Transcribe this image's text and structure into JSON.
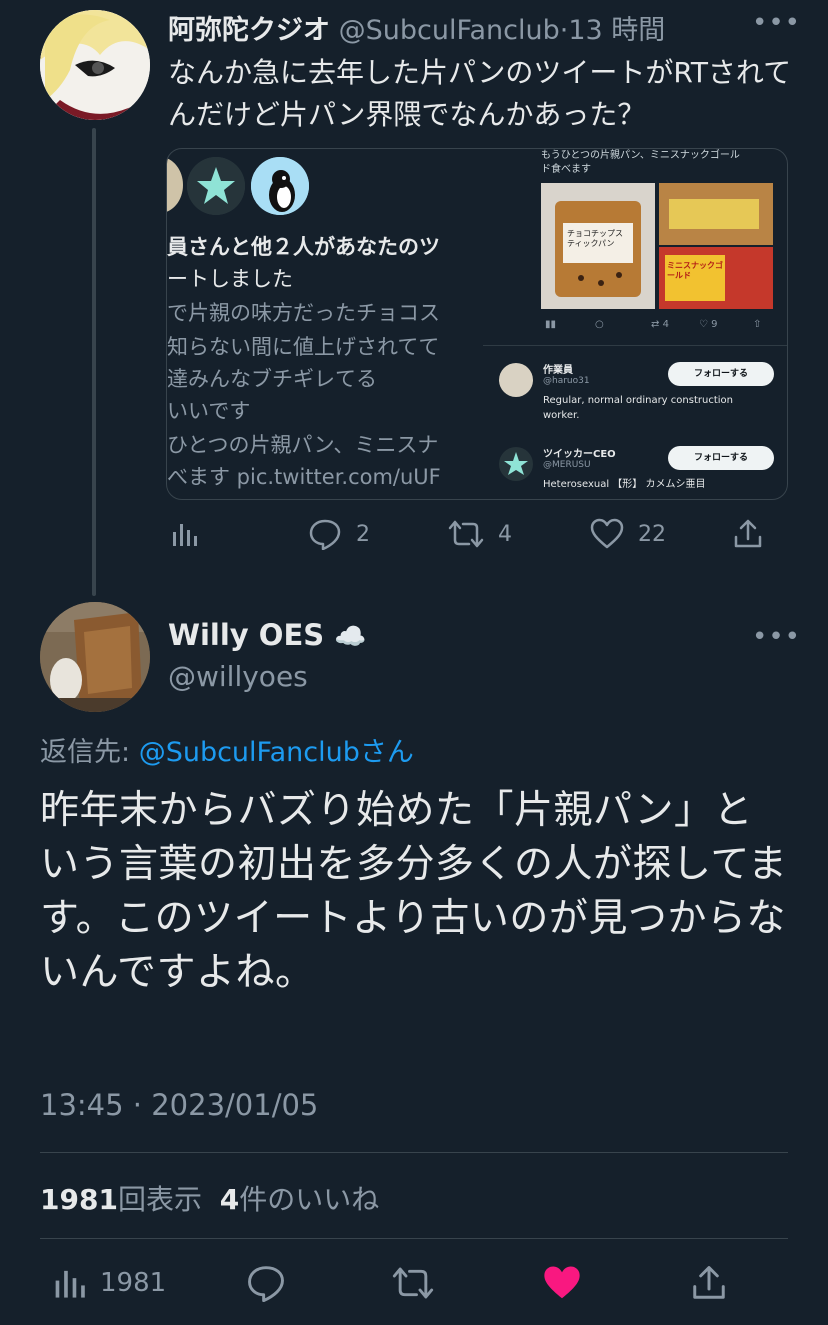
{
  "parent_tweet": {
    "display_name": "阿弥陀クジオ",
    "handle": "@SubculFanclub",
    "separator": "·",
    "time": "13 時間",
    "more": "•••",
    "text": "なんか急に去年した片パンのツイートがRTされてんだけど片パン界隈でなんかあった？",
    "embedded": {
      "notification_lines": [
        "員さんと他２人があなたのツ",
        "ートしました",
        "で片親の味方だったチョコス",
        "知らない間に値上げされてて",
        "達みんなブチギレてる",
        "いいです",
        "ひとつの片親パン、ミニスナ",
        "べます pic.twitter.com/uUF"
      ],
      "right_caption": "もうひとつの片親パン、ミニスナックゴールド食べます",
      "bread_labels": [
        "チョコチップスティックパン",
        "ミニスナックゴールド"
      ],
      "mini_actions": {
        "retweets": "4",
        "likes": "9"
      },
      "accounts": [
        {
          "name": "作業員",
          "handle": "@haruo31",
          "bio": "Regular, normal ordinary construction worker.",
          "button": "フォローする"
        },
        {
          "name": "ツイッカーCEO",
          "handle": "@MERUSU",
          "bio": "Heterosexual 【形】 カメムシ亜目",
          "button": "フォローする"
        }
      ]
    },
    "actions": {
      "replies": "2",
      "retweets": "4",
      "likes": "22"
    }
  },
  "reply_tweet": {
    "display_name": "Willy OES",
    "name_emoji": "☁️",
    "handle": "@willyoes",
    "more": "•••",
    "reply_to_prefix": "返信先: ",
    "reply_to_handle": "@SubculFanclub",
    "reply_to_suffix": "さん",
    "text": "昨年末からバズり始めた「片親パン」という言葉の初出を多分多くの人が探してます。このツイートより古いのが見つからないんですよね。",
    "timestamp": "13:45 · 2023/01/05",
    "views_count": "1981",
    "views_label": "回表示",
    "likes_count": "4",
    "likes_label": "件のいいね",
    "bottom_views": "1981"
  },
  "colors": {
    "background": "#15202b",
    "text": "#e7e9ea",
    "muted": "#8b98a5",
    "link": "#1d9bf0",
    "like": "#f91880",
    "divider": "#38444d"
  }
}
